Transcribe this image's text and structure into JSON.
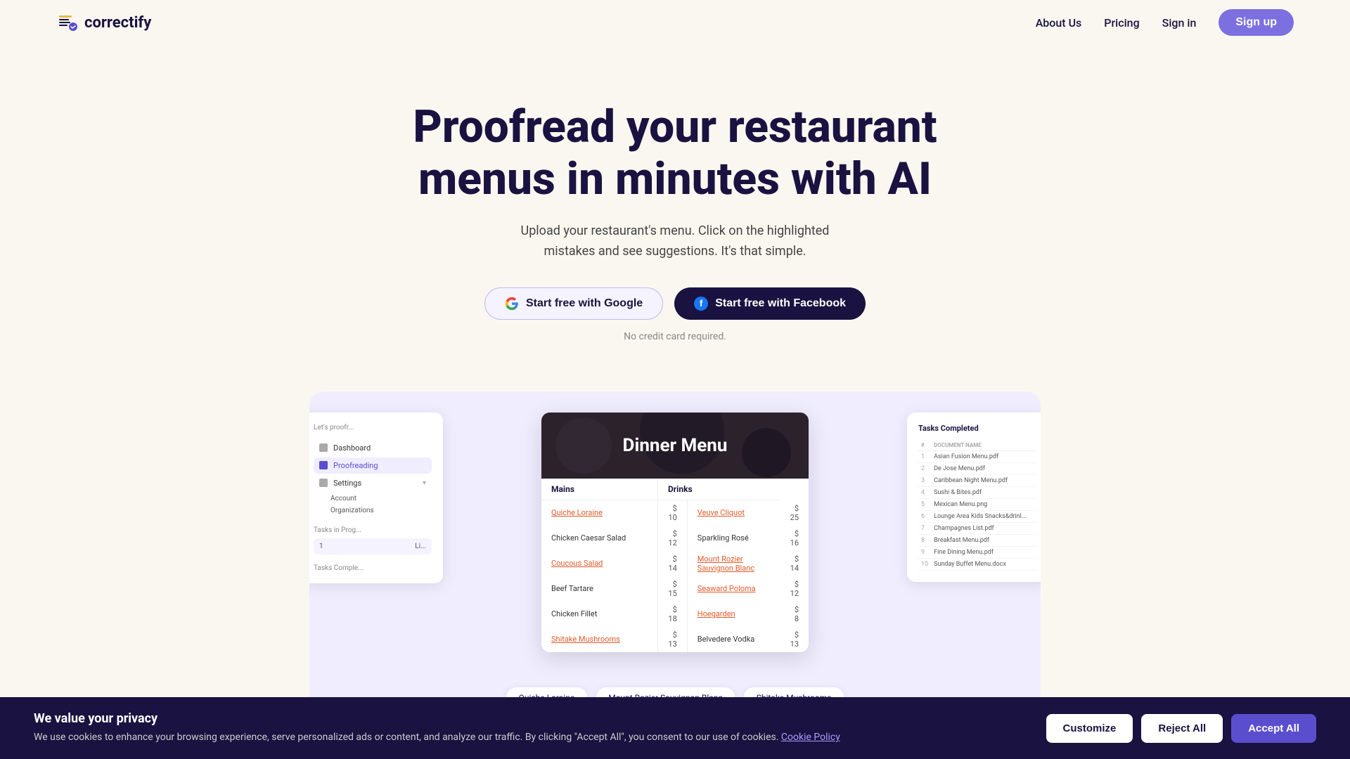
{
  "nav": {
    "logo_text": "correctify",
    "links": [
      {
        "label": "About Us",
        "id": "about-us"
      },
      {
        "label": "Pricing",
        "id": "pricing"
      },
      {
        "label": "Sign in",
        "id": "sign-in"
      }
    ],
    "signup_label": "Sign up"
  },
  "hero": {
    "title": "Proofread your restaurant menus in minutes with AI",
    "subtitle": "Upload your restaurant's menu. Click on the highlighted mistakes and see suggestions. It's that simple.",
    "btn_google": "Start free with Google",
    "btn_facebook": "Start free with Facebook",
    "no_cc": "No credit card required."
  },
  "preview": {
    "dinner_menu_title": "Dinner Menu",
    "mains_header": "Mains",
    "drinks_header": "Drinks",
    "mains": [
      {
        "name": "Quiche Loraine",
        "price": "$ 10",
        "link": true
      },
      {
        "name": "Chicken Caesar Salad",
        "price": "$ 12",
        "link": false
      },
      {
        "name": "Coucous Salad",
        "price": "$ 14",
        "link": true
      },
      {
        "name": "Beef Tartare",
        "price": "$ 15",
        "link": false
      },
      {
        "name": "Chicken Fillet",
        "price": "$ 18",
        "link": false
      },
      {
        "name": "Shitake Mushrooms",
        "price": "$ 13",
        "link": true
      }
    ],
    "drinks": [
      {
        "name": "Veuve Cliquot",
        "price": "$ 25",
        "link": true
      },
      {
        "name": "Sparkling Rosé",
        "price": "$ 16",
        "link": false
      },
      {
        "name": "Mount Rozier Sauvignon Blanc",
        "price": "$ 14",
        "link": true
      },
      {
        "name": "Seaward Poloma",
        "price": "$ 12",
        "link": true
      },
      {
        "name": "Hoegarden",
        "price": "$ 8",
        "link": true
      },
      {
        "name": "Belvedere Vodka",
        "price": "$ 13",
        "link": false
      }
    ],
    "sidebar": {
      "header": "Let's proofr...",
      "nav_items": [
        {
          "label": "Dashboard",
          "active": false
        },
        {
          "label": "Proofreading",
          "active": false
        },
        {
          "label": "Settings",
          "active": false
        }
      ],
      "sub_items": [
        "Account",
        "Organizations"
      ],
      "tasks_in_progress_label": "Tasks in Prog...",
      "tasks_completed_label": "Tasks Comple..."
    },
    "completed_panel": {
      "title": "Tasks Completed",
      "headers": [
        "#",
        "DOCUMENT NAME"
      ],
      "rows": [
        {
          "num": "1",
          "name": "Asian Fusion Menu.pdf"
        },
        {
          "num": "2",
          "name": "De Jose Menu.pdf"
        },
        {
          "num": "3",
          "name": "Caribbean Night Menu.pdf"
        },
        {
          "num": "4",
          "name": "Sushi & Bites.pdf"
        },
        {
          "num": "5",
          "name": "Mexican Menu.png"
        },
        {
          "num": "6",
          "name": "Lounge Area Kids Snacks&drinl..."
        },
        {
          "num": "7",
          "name": "Champagnes List.pdf"
        },
        {
          "num": "8",
          "name": "Breakfast Menu.pdf"
        },
        {
          "num": "9",
          "name": "Fine Dining Menu.pdf"
        },
        {
          "num": "10",
          "name": "Sunday Buffet Menu.docx"
        }
      ]
    },
    "chips": [
      "Quiche Loraine",
      "Mount Rozier Sauvignon Blanc",
      "Shitake Mushrooms"
    ]
  },
  "cookie": {
    "title": "We value your privacy",
    "description": "We use cookies to enhance your browsing experience, serve personalized ads or content, and analyze our traffic. By clicking \"Accept All\", you consent to our use of cookies.",
    "link_text": "Cookie Policy",
    "btn_customize": "Customize",
    "btn_reject": "Reject All",
    "btn_accept": "Accept All"
  }
}
